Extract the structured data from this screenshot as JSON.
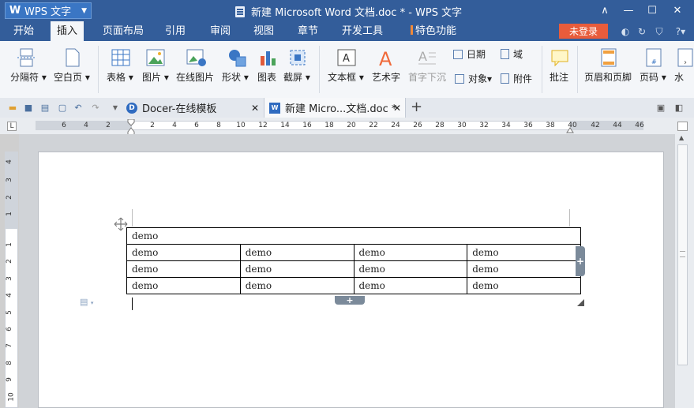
{
  "app": {
    "name": "WPS 文字",
    "logo": "W",
    "window_title": "新建 Microsoft Word 文档.doc * - WPS 文字"
  },
  "window_controls": {
    "collapse": "∧",
    "minimize": "—",
    "maximize": "☐",
    "close": "✕"
  },
  "menu_tabs": [
    "开始",
    "插入",
    "页面布局",
    "引用",
    "审阅",
    "视图",
    "章节",
    "开发工具",
    "特色功能"
  ],
  "active_tab": "插入",
  "login_label": "未登录",
  "ribbon": {
    "big": [
      "分隔符",
      "空白页",
      "表格",
      "图片",
      "在线图片",
      "形状",
      "图表",
      "截屏",
      "文本框",
      "艺术字",
      "首字下沉",
      "批注",
      "页眉和页脚",
      "页码",
      "水"
    ],
    "small": {
      "date": "日期",
      "field": "域",
      "object": "对象",
      "attachment": "附件"
    }
  },
  "doc_tabs": [
    {
      "label": "Docer-在线模板",
      "close": "✕"
    },
    {
      "label": "新建 Micro...文档.doc *",
      "close": "✕"
    }
  ],
  "new_tab": "+",
  "ruler": {
    "h_ticks": [
      "6",
      "4",
      "2",
      "2",
      "4",
      "6",
      "8",
      "10",
      "12",
      "14",
      "16",
      "18",
      "20",
      "22",
      "24",
      "26",
      "28",
      "30",
      "32",
      "34",
      "36",
      "38",
      "40",
      "42",
      "44",
      "46"
    ],
    "v_ticks": [
      "4",
      "3",
      "2",
      "1",
      "1",
      "2",
      "3",
      "4",
      "5",
      "6",
      "7",
      "8",
      "9",
      "10"
    ]
  },
  "table": {
    "header": "demo",
    "rows": [
      [
        "demo",
        "demo",
        "demo",
        "demo"
      ],
      [
        "demo",
        "demo",
        "demo",
        "demo"
      ],
      [
        "demo",
        "demo",
        "demo",
        "demo"
      ]
    ]
  },
  "table_add": "+"
}
